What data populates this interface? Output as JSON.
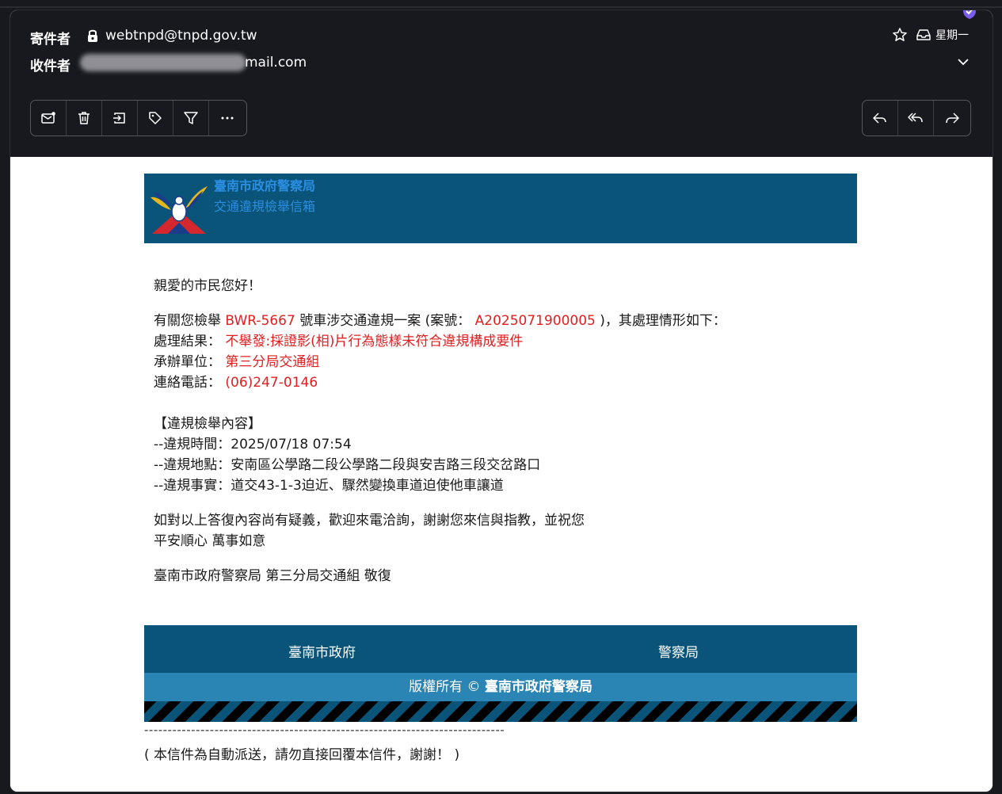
{
  "header": {
    "from_label": "寄件者",
    "from_address": "webtnpd@tnpd.gov.tw",
    "to_label": "收件者",
    "to_address_visible": "mail.com",
    "date": "星期一"
  },
  "toolbar": {
    "left": [
      "mark-unread-icon",
      "trash-icon",
      "move-icon",
      "tag-icon",
      "filter-icon",
      "more-icon"
    ],
    "right": [
      "reply-icon",
      "reply-all-icon",
      "forward-icon"
    ]
  },
  "email": {
    "banner": {
      "org": "臺南市政府警察局",
      "subtitle": "交通違規檢舉信箱"
    },
    "greeting": "親愛的市民您好！",
    "intro": {
      "t1": "有關您檢舉 ",
      "plate": "BWR-5667",
      "t2": " 號車涉交通違規一案 (案號： ",
      "case_no": "A2025071900005",
      "t3": " )，其處理情形如下："
    },
    "result_label": "處理結果：",
    "result_value": "不舉發:採證影(相)片行為態樣未符合違規構成要件",
    "unit_label": "承辦單位：",
    "unit_value": "第三分局交通組",
    "phone_label": "連絡電話：",
    "phone_value": "(06)247-0146",
    "section_title": "【違規檢舉內容】",
    "violation_time": "--違規時間：2025/07/18 07:54",
    "violation_place": "--違規地點：安南區公學路二段公學路二段與安吉路三段交岔路口",
    "violation_fact": "--違規事實：道交43-1-3迫近、驟然變換車道迫使他車讓道",
    "closing1": "如對以上答復內容尚有疑義，歡迎來電洽詢，謝謝您來信與指教，並祝您",
    "closing2": "平安順心 萬事如意",
    "signature": "臺南市政府警察局 第三分局交通組 敬復",
    "footer": {
      "link1": "臺南市政府",
      "link2": "警察局",
      "copyright_prefix": "版權所有 © ",
      "copyright_org": "臺南市政府警察局"
    },
    "dash_line": "-----------------------------------------------------------------------------",
    "auto_note": "( 本信件為自動派送，請勿直接回覆本信件，謝謝！ )"
  },
  "colors": {
    "header_bg": "#18181f",
    "banner_bg": "#0a5479",
    "banner_text": "#2b8ee0",
    "copyright_bg": "#2a85b5",
    "highlight": "#e02020",
    "shield": "#7b5cf0"
  }
}
